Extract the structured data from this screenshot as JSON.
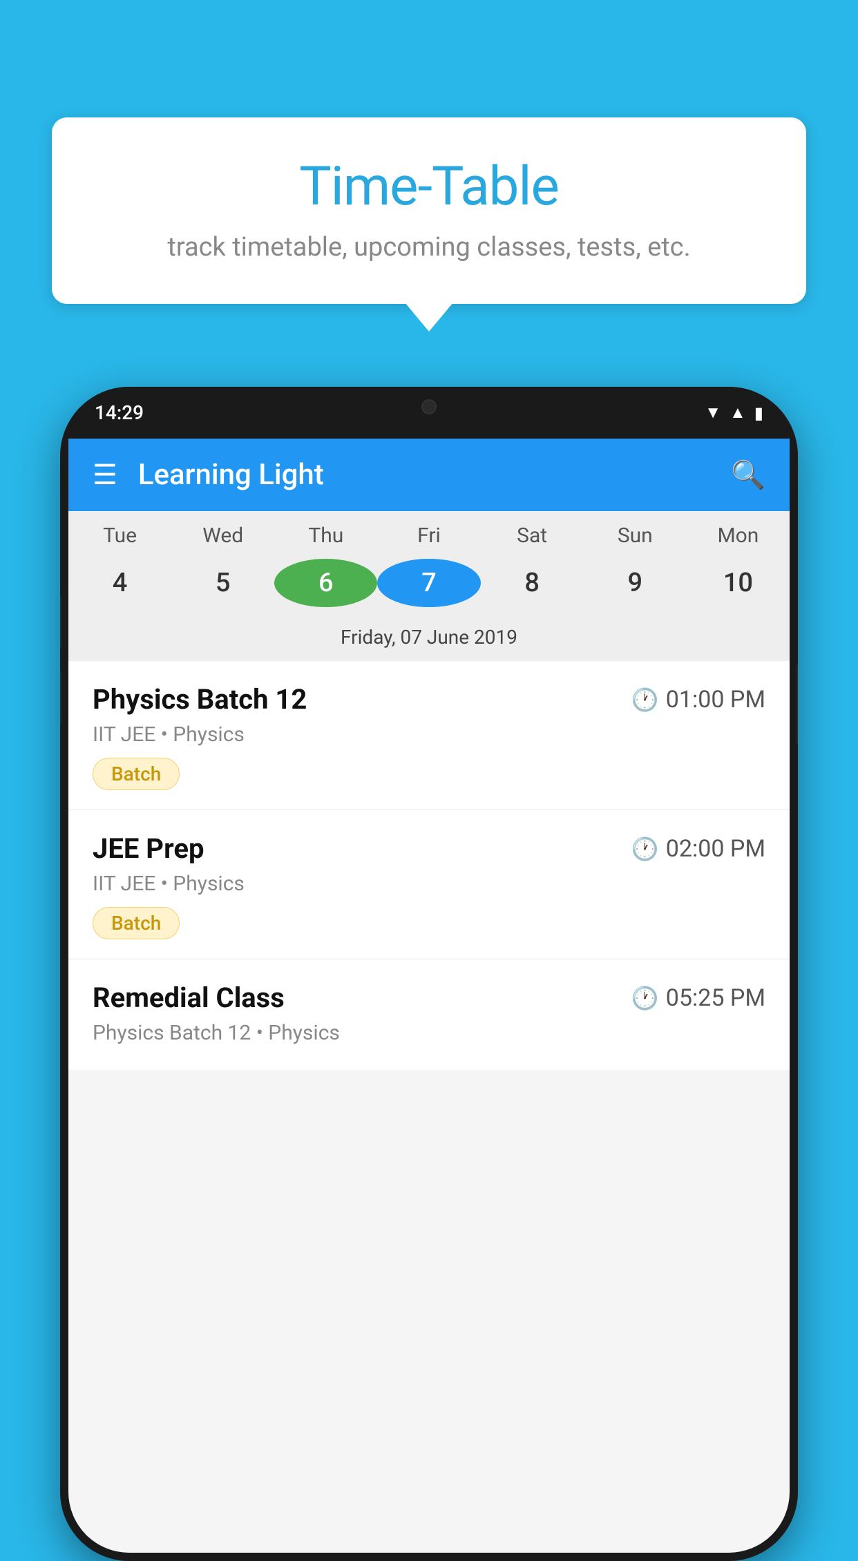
{
  "background_color": "#29b6e8",
  "bubble": {
    "title": "Time-Table",
    "subtitle": "track timetable, upcoming classes, tests, etc."
  },
  "phone": {
    "time": "14:29",
    "app_name": "Learning Light",
    "calendar": {
      "days_of_week": [
        "Tue",
        "Wed",
        "Thu",
        "Fri",
        "Sat",
        "Sun",
        "Mon"
      ],
      "dates": [
        "4",
        "5",
        "6",
        "7",
        "8",
        "9",
        "10"
      ],
      "today_index": 2,
      "selected_index": 3,
      "selected_date_label": "Friday, 07 June 2019"
    },
    "schedule": [
      {
        "title": "Physics Batch 12",
        "time": "01:00 PM",
        "meta": "IIT JEE • Physics",
        "tag": "Batch"
      },
      {
        "title": "JEE Prep",
        "time": "02:00 PM",
        "meta": "IIT JEE • Physics",
        "tag": "Batch"
      },
      {
        "title": "Remedial Class",
        "time": "05:25 PM",
        "meta": "Physics Batch 12 • Physics",
        "tag": null
      }
    ]
  },
  "icons": {
    "menu": "☰",
    "search": "🔍",
    "clock": "🕐"
  }
}
